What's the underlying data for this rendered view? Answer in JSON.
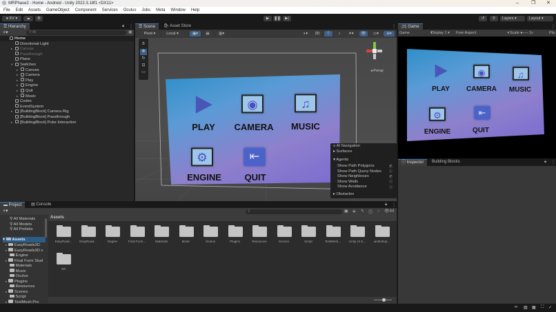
{
  "window": {
    "title": "MRPhase2 - Home - Android - Unity 2022.3.18f1 <DX11>"
  },
  "menu": [
    "File",
    "Edit",
    "Assets",
    "GameObject",
    "Component",
    "Services",
    "Oculus",
    "Jobs",
    "Meta",
    "Window",
    "Help"
  ],
  "toolbar": {
    "account": "KV",
    "layers": "Layers",
    "layout": "Layout"
  },
  "hierarchy": {
    "tab": "Hierarchy",
    "search_placeholder": "All",
    "items": [
      {
        "label": "Home",
        "depth": 0,
        "expanded": true,
        "bold": true
      },
      {
        "label": "Directional Light",
        "depth": 1
      },
      {
        "label": "Canvas",
        "depth": 1,
        "disabled": true,
        "has_children": true
      },
      {
        "label": "Passthrough",
        "depth": 1,
        "disabled": true
      },
      {
        "label": "Plane",
        "depth": 1
      },
      {
        "label": "Switches",
        "depth": 1,
        "expanded": true
      },
      {
        "label": "Canvas",
        "depth": 2,
        "has_children": true
      },
      {
        "label": "Camera",
        "depth": 2,
        "has_children": true
      },
      {
        "label": "Play",
        "depth": 2,
        "has_children": true
      },
      {
        "label": "Engine",
        "depth": 2,
        "has_children": true
      },
      {
        "label": "Quit",
        "depth": 2,
        "has_children": true
      },
      {
        "label": "Music",
        "depth": 2,
        "has_children": true
      },
      {
        "label": "Codes",
        "depth": 1
      },
      {
        "label": "EventSystem",
        "depth": 1
      },
      {
        "label": "[BuildingBlock] Camera Rig",
        "depth": 1,
        "has_children": true
      },
      {
        "label": "[BuildingBlock] Passthrough",
        "depth": 1
      },
      {
        "label": "[BuildingBlock] Poke Interaction",
        "depth": 1,
        "has_children": true
      }
    ]
  },
  "scene": {
    "tabs": [
      "Scene",
      "Asset Store"
    ],
    "pivot": "Pivot",
    "local": "Local",
    "mode_2d": "2D",
    "persp": "Persp",
    "ui_buttons": [
      "PLAY",
      "CAMERA",
      "MUSIC",
      "ENGINE",
      "QUIT"
    ],
    "ai_navigation": {
      "title": "AI Navigation",
      "surfaces": "Surfaces",
      "agents": "Agents",
      "options": [
        {
          "label": "Show Path Polygons",
          "checked": true
        },
        {
          "label": "Show Path Query Nodes",
          "checked": false
        },
        {
          "label": "Show Neighbours",
          "checked": true
        },
        {
          "label": "Show Walls",
          "checked": false
        },
        {
          "label": "Show Avoidance",
          "checked": false
        }
      ],
      "obstacles": "Obstacles"
    }
  },
  "game": {
    "tab": "Game",
    "mode": "Game",
    "display": "Display 1",
    "aspect": "Free Aspect",
    "scale_label": "Scale",
    "scale_value": "1x",
    "play": "Pla"
  },
  "inspector": {
    "tabs": [
      "Inspector",
      "Building Blocks"
    ]
  },
  "project": {
    "tabs": [
      "Project",
      "Console"
    ],
    "favorites": [
      "All Materials",
      "All Models",
      "All Prefabs"
    ],
    "root": "Assets",
    "tree": [
      "EasyRoads3D",
      "EasyRoads3D s",
      "Engine",
      "Final Form Stud",
      "Materials",
      "Music",
      "Oculus",
      "Plugins",
      "Resources",
      "Scenes",
      "Script",
      "TextMesh Pro"
    ],
    "breadcrumb": "Assets",
    "hidden_count": "44",
    "folders": [
      "EasyRoad...",
      "EasyRoad...",
      "Engine",
      "Final Form...",
      "Materials",
      "Music",
      "Oculus",
      "Plugins",
      "Resources",
      "Scenes",
      "Script",
      "TextMesh...",
      "Unity UI S...",
      "workshop...",
      "XR"
    ]
  }
}
